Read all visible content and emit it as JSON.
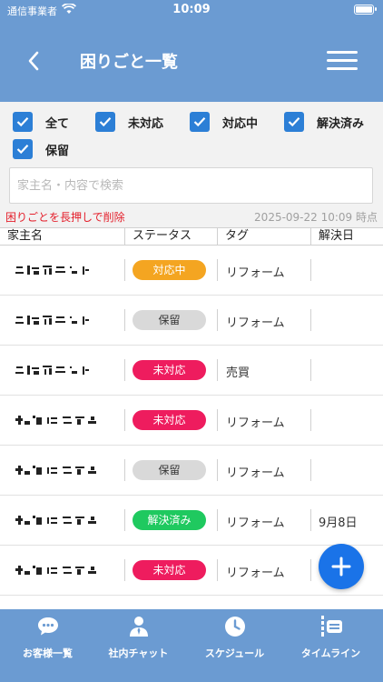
{
  "status_bar": {
    "carrier": "通信事業者",
    "time": "10:09",
    "battery_level": 0.9
  },
  "nav": {
    "title": "困りごと一覧"
  },
  "filters": [
    {
      "label": "全て",
      "checked": true
    },
    {
      "label": "未対応",
      "checked": true
    },
    {
      "label": "対応中",
      "checked": true
    },
    {
      "label": "解決済み",
      "checked": true
    },
    {
      "label": "保留",
      "checked": true
    }
  ],
  "search": {
    "placeholder": "家主名・内容で検索",
    "value": ""
  },
  "hint": "困りごとを長押しで削除",
  "timestamp": "2025-09-22 10:09 時点",
  "table": {
    "headers": [
      "家主名",
      "ステータス",
      "タグ",
      "解決日"
    ],
    "rows": [
      {
        "status": "対応中",
        "tag": "リフォーム",
        "resolved": ""
      },
      {
        "status": "保留",
        "tag": "リフォーム",
        "resolved": ""
      },
      {
        "status": "未対応",
        "tag": "売買",
        "resolved": ""
      },
      {
        "status": "未対応",
        "tag": "リフォーム",
        "resolved": ""
      },
      {
        "status": "保留",
        "tag": "リフォーム",
        "resolved": ""
      },
      {
        "status": "解決済み",
        "tag": "リフォーム",
        "resolved": "9月8日"
      },
      {
        "status": "未対応",
        "tag": "リフォーム",
        "resolved": ""
      }
    ]
  },
  "status_colors": {
    "対応中": {
      "bg": "#f4a521",
      "fg": "#ffffff"
    },
    "保留": {
      "bg": "#d9d9d9",
      "fg": "#333333"
    },
    "未対応": {
      "bg": "#ee1c5e",
      "fg": "#ffffff"
    },
    "解決済み": {
      "bg": "#1fc95f",
      "fg": "#ffffff"
    }
  },
  "tabs": [
    {
      "label": "お客様一覧",
      "icon": "chat-bubble-icon"
    },
    {
      "label": "社内チャット",
      "icon": "person-icon"
    },
    {
      "label": "スケジュール",
      "icon": "clock-icon"
    },
    {
      "label": "タイムライン",
      "icon": "timeline-icon"
    }
  ],
  "colors": {
    "primary": "#6b9bd2",
    "checkbox": "#2c7fd6",
    "fab": "#1a73e8",
    "hint": "#e4202c"
  }
}
